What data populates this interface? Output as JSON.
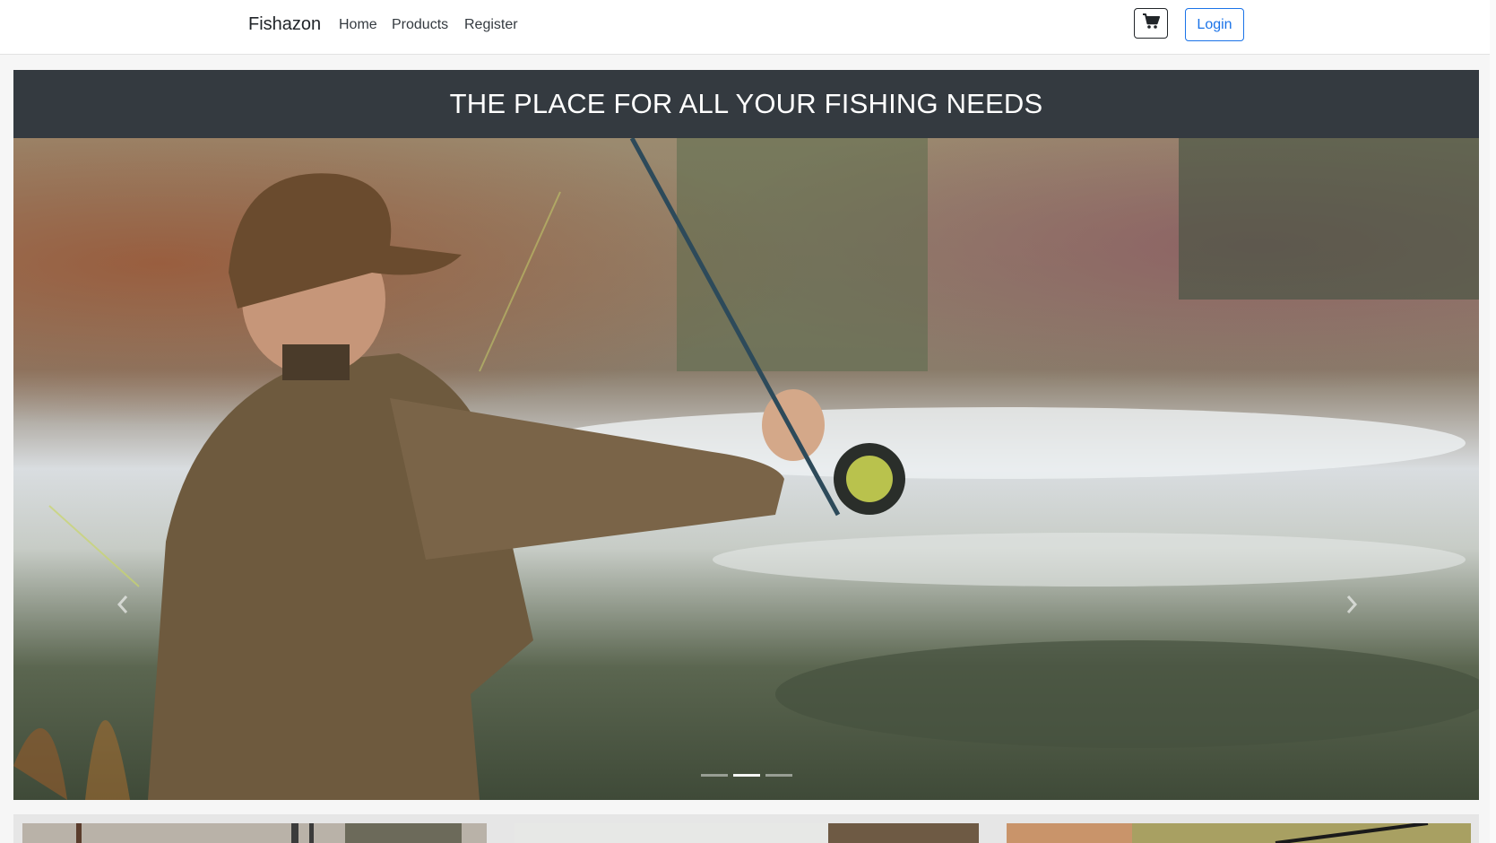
{
  "navbar": {
    "brand": "Fishazon",
    "links": [
      "Home",
      "Products",
      "Register"
    ],
    "cart_icon": "shopping-cart-icon",
    "login_label": "Login"
  },
  "banner": {
    "heading": "THE PLACE FOR ALL YOUR FISHING NEEDS"
  },
  "carousel": {
    "prev_icon": "chevron-left-icon",
    "next_icon": "chevron-right-icon",
    "slide_count": 3,
    "active_slide": 2
  },
  "colors": {
    "banner_bg": "#343a40",
    "login_accent": "#1a73e8",
    "text_dark": "#212529"
  }
}
